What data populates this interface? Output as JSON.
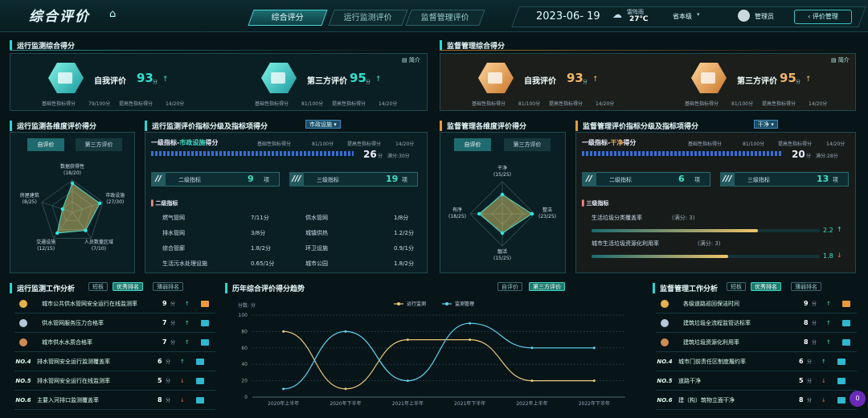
{
  "header": {
    "title": "综合评价",
    "tabs": [
      "综合评分",
      "运行监测评价",
      "监督管理评价"
    ],
    "date": "2023-06- 19",
    "weather": "雷阵雨",
    "temperature": "27℃",
    "level": "省本级",
    "user": "管理员",
    "mgmt_button": "评价管理"
  },
  "left_top": {
    "title": "运行监测综合得分",
    "brief": "简介",
    "cards": [
      {
        "label": "自我评价",
        "score": "93",
        "unit": "分",
        "basic_label": "基础性指标得分",
        "basic": "79/100分",
        "improve_label": "提高性指标得分",
        "improve": "14/20分"
      },
      {
        "label": "第三方评价",
        "score": "95",
        "unit": "分",
        "basic_label": "基础性指标得分",
        "basic": "81/100分",
        "improve_label": "提高性指标得分",
        "improve": "14/20分"
      }
    ]
  },
  "right_top": {
    "title": "监督管理综合得分",
    "brief": "简介",
    "cards": [
      {
        "label": "自我评价",
        "score": "93",
        "unit": "分",
        "basic_label": "基础性指标得分",
        "basic": "81/100分",
        "improve_label": "提高性指标得分",
        "improve": "14/20分"
      },
      {
        "label": "第三方评价",
        "score": "95",
        "unit": "分",
        "basic_label": "基础性指标得分",
        "basic": "81/100分",
        "improve_label": "提高性指标得分",
        "improve": "14/20分"
      }
    ]
  },
  "left_dim": {
    "title": "运行监测各维度评价得分",
    "toggles": [
      "自评价",
      "第三方评价"
    ],
    "labels": [
      "数据获得性\n(18/20)",
      "市政设施\n(27/30)",
      "人员数量区域\n(7/10)",
      "交通设施\n(12/15)",
      "房屋建筑\n(8/25)"
    ],
    "values": [
      0.9,
      0.9,
      0.7,
      0.8,
      0.32
    ]
  },
  "left_idx": {
    "title": "运行监测评价指标分级及指标项得分",
    "select": "市政设施",
    "level1": "一级指标-",
    "level1_name": "市政设施",
    "level1_suffix": "得分",
    "basic_label": "基础性指标得分",
    "basic": "81/100分",
    "improve_label": "提高性指标得分",
    "improve": "14/20分",
    "score": "26",
    "score_unit": "分",
    "full": "满分:30分",
    "lv2": "二级指标",
    "lv2_count": "9",
    "lv3": "三级指标",
    "lv3_count": "19",
    "unit_x": "项",
    "sub_title": "二级指标",
    "items": [
      [
        "燃气管网",
        "7/11分",
        "供水管网",
        "1/8分"
      ],
      [
        "排水管网",
        "3/8分",
        "城镇供热",
        "1.2/2分"
      ],
      [
        "综合管廊",
        "1.8/2分",
        "环卫设施",
        "0.9/1分"
      ],
      [
        "生活污水处理设施",
        "0.65/1分",
        "城市公园",
        "1.8/2分"
      ]
    ]
  },
  "right_dim": {
    "title": "监督管理各维度评价得分",
    "toggles": [
      "自评价",
      "第三方评价"
    ],
    "labels": [
      "干净\n(15/25)",
      "整洁\n(23/25)",
      "靓活\n(15/25)",
      "有序\n(18/25)"
    ],
    "values": [
      0.6,
      0.92,
      0.6,
      0.72
    ]
  },
  "right_idx": {
    "title": "监督管理评价指标分级及指标项得分",
    "select": "干净",
    "level1": "一级指标-",
    "level1_name": "干净",
    "level1_suffix": "得分",
    "basic_label": "基础性指标得分",
    "basic": "81/100分",
    "improve_label": "提高性指标得分",
    "improve": "14/20分",
    "score": "20",
    "score_unit": "分",
    "full": "满分:28分",
    "lv2": "二级指标",
    "lv2_count": "6",
    "lv3": "三级指标",
    "lv3_count": "13",
    "unit_x": "项",
    "sub_title": "三级指标",
    "bars": [
      {
        "label": "生活垃圾分类覆盖率",
        "full": "(满分: 3)",
        "value": "2.2",
        "pct": 0.73,
        "trend": "up"
      },
      {
        "label": "城市生活垃圾资源化利用率",
        "full": "(满分: 3)",
        "value": "1.8",
        "pct": 0.6,
        "trend": "down"
      }
    ]
  },
  "left_work": {
    "title": "运行监测工作分析",
    "tabs": [
      "短板",
      "优秀排名",
      "薄弱排名"
    ],
    "rows": [
      {
        "rank": "1",
        "name": "城市公共供水管网安全运行在线监测率",
        "score": "9",
        "unit": "分"
      },
      {
        "rank": "2",
        "name": "供水管网服务压力合格率",
        "score": "7",
        "unit": "分"
      },
      {
        "rank": "3",
        "name": "城市供水水质合格率",
        "score": "7",
        "unit": "分"
      },
      {
        "rank": "NO.4",
        "name": "排水管网安全运行监测覆盖率",
        "score": "6",
        "unit": "分"
      },
      {
        "rank": "NO.5",
        "name": "排水管网安全运行在线监测率",
        "score": "5",
        "unit": "分"
      },
      {
        "rank": "NO.6",
        "name": "主要入河排口监测覆盖率",
        "score": "8",
        "unit": "分"
      }
    ]
  },
  "trend": {
    "title": "历年综合评价得分趋势",
    "tabs": [
      "自评价",
      "第三方评价"
    ]
  },
  "chart_data": {
    "type": "line",
    "ylabel": "分数: 分",
    "ylim": [
      0,
      100
    ],
    "categories": [
      "2020年上半年",
      "2020年下半年",
      "2021年上半年",
      "2021年下半年",
      "2022年上半年",
      "2022年下半年"
    ],
    "series": [
      {
        "name": "运行监测",
        "color": "#e8c77a",
        "values": [
          80,
          10,
          70,
          70,
          20,
          20
        ]
      },
      {
        "name": "监测管理",
        "color": "#5fd3f0",
        "values": [
          10,
          80,
          20,
          90,
          60,
          60
        ]
      }
    ]
  },
  "right_work": {
    "title": "监督管理工作分析",
    "tabs": [
      "短板",
      "优秀排名",
      "薄弱排名"
    ],
    "rows": [
      {
        "rank": "1",
        "name": "各级道路巡回保洁时间",
        "score": "9",
        "unit": "分"
      },
      {
        "rank": "2",
        "name": "建筑垃圾全流程监管达标率",
        "score": "8",
        "unit": "分"
      },
      {
        "rank": "3",
        "name": "建筑垃圾资源化利用率",
        "score": "8",
        "unit": "分"
      },
      {
        "rank": "NO.4",
        "name": "城市门前责任区制度履约率",
        "score": "6",
        "unit": "分"
      },
      {
        "rank": "NO.5",
        "name": "道路干净",
        "score": "5",
        "unit": "分"
      },
      {
        "rank": "NO.6",
        "name": "建（构）筑物立面干净",
        "score": "8",
        "unit": "分"
      }
    ]
  },
  "badge": "0"
}
